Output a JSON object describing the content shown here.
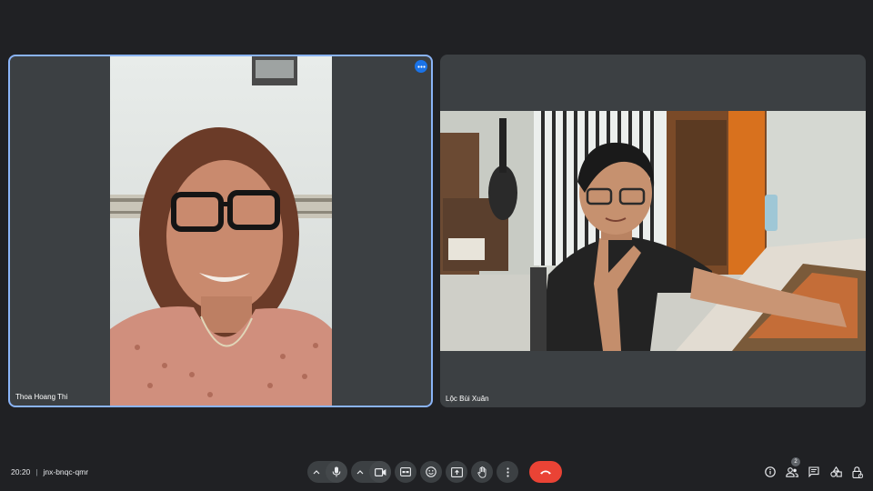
{
  "participants": [
    {
      "name": "Thoa Hoang Thi",
      "active_speaker": true
    },
    {
      "name": "Lộc Bùi Xuân",
      "active_speaker": false
    }
  ],
  "meeting": {
    "time": "20:20",
    "separator": "|",
    "code": "jnx-bnqc-qmr"
  },
  "controls": [
    "mic-toggle",
    "camera-toggle",
    "captions",
    "reactions",
    "present-screen",
    "raise-hand",
    "more-options",
    "leave-call"
  ],
  "people_count": "2",
  "colors": {
    "background": "#202124",
    "tile": "#3c4043",
    "active_border": "#8ab4f8",
    "end_call": "#ea4335",
    "accent": "#1a73e8"
  }
}
